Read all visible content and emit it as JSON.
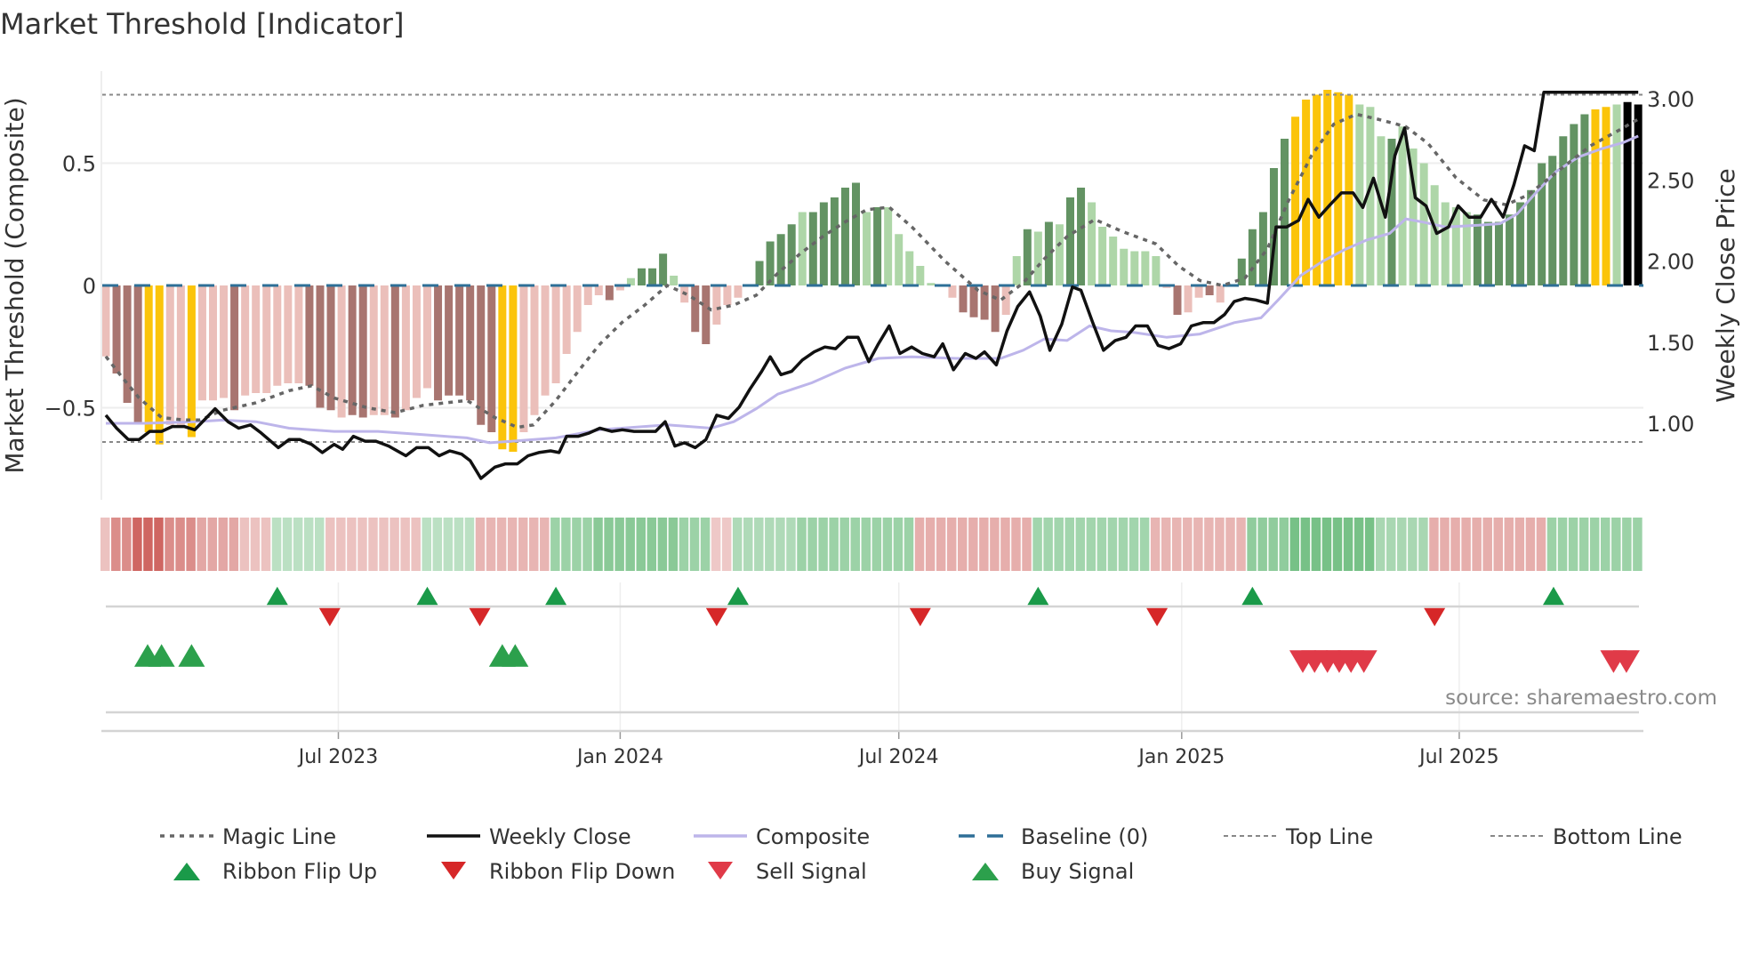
{
  "title": "Market Threshold [Indicator]",
  "source": "source: sharemaestro.com",
  "colors": {
    "bar_L": "#ebbfba",
    "bar_D": "#a87570",
    "bar_Y": "#fbc40a",
    "bar_g": "#aed6a8",
    "bar_G": "#639363",
    "close": "#111111",
    "composite": "#bdb5ea",
    "magic": "#666666",
    "baseline": "#2e6f97",
    "flip_up": "#1a9a49",
    "flip_down": "#d62728",
    "buy": "#2ca04c",
    "sell": "#e03a48"
  },
  "chart_data": {
    "type": "bar",
    "title": "Market Threshold [Indicator]",
    "ylabel_left": "Market Threshold (Composite)",
    "ylabel_right": "Weekly Close Price",
    "ylim_left": [
      -0.88,
      0.88
    ],
    "ylim_right": [
      0.55,
      3.25
    ],
    "left_ticks": [
      {
        "v": 0.5,
        "label": "0.5"
      },
      {
        "v": 0,
        "label": "0"
      },
      {
        "v": -0.5,
        "label": "−0.5"
      }
    ],
    "right_ticks": [
      {
        "v": 3.0,
        "label": "3.00"
      },
      {
        "v": 2.5,
        "label": "2.50"
      },
      {
        "v": 2.0,
        "label": "2.00"
      },
      {
        "v": 1.5,
        "label": "1.50"
      },
      {
        "v": 1.0,
        "label": "1.00"
      }
    ],
    "top_line": 0.78,
    "bottom_line": -0.64,
    "x_ticks": [
      {
        "w": 21.7,
        "label": "Jul 2023"
      },
      {
        "w": 48.0,
        "label": "Jan 2024"
      },
      {
        "w": 74.0,
        "label": "Jul 2024"
      },
      {
        "w": 100.4,
        "label": "Jan 2025"
      },
      {
        "w": 126.3,
        "label": "Jul 2025"
      }
    ],
    "composite_bars": [
      -0.29,
      -0.36,
      -0.48,
      -0.56,
      -0.6,
      -0.65,
      -0.57,
      -0.57,
      -0.62,
      -0.47,
      -0.47,
      -0.46,
      -0.51,
      -0.45,
      -0.44,
      -0.44,
      -0.41,
      -0.4,
      -0.4,
      -0.41,
      -0.5,
      -0.51,
      -0.54,
      -0.53,
      -0.54,
      -0.53,
      -0.53,
      -0.54,
      -0.51,
      -0.46,
      -0.42,
      -0.47,
      -0.45,
      -0.45,
      -0.47,
      -0.57,
      -0.6,
      -0.67,
      -0.68,
      -0.6,
      -0.53,
      -0.45,
      -0.4,
      -0.28,
      -0.19,
      -0.08,
      -0.04,
      -0.06,
      -0.02,
      0.03,
      0.07,
      0.07,
      0.13,
      0.04,
      -0.07,
      -0.19,
      -0.24,
      -0.16,
      -0.08,
      -0.05,
      0,
      0.1,
      0.18,
      0.21,
      0.25,
      0.3,
      0.3,
      0.34,
      0.36,
      0.4,
      0.42,
      0.3,
      0.32,
      0.32,
      0.21,
      0.14,
      0.08,
      0.01,
      0,
      -0.05,
      -0.11,
      -0.13,
      -0.14,
      -0.19,
      -0.12,
      0.12,
      0.23,
      0.22,
      0.26,
      0.25,
      0.36,
      0.4,
      0.34,
      0.24,
      0.2,
      0.15,
      0.14,
      0.14,
      0.12,
      -0.01,
      -0.12,
      -0.11,
      -0.05,
      -0.04,
      -0.07,
      0,
      0.11,
      0.23,
      0.3,
      0.48,
      0.6,
      0.69,
      0.76,
      0.78,
      0.8,
      0.79,
      0.78,
      0.74,
      0.73,
      0.61,
      0.6,
      0.65,
      0.56,
      0.5,
      0.41,
      0.34,
      0.32,
      0.3,
      0.29,
      0.26,
      0.26,
      0.29,
      0.34,
      0.39,
      0.5,
      0.53,
      0.61,
      0.66,
      0.7,
      0.72,
      0.73,
      0.74,
      0.75,
      0.74
    ],
    "bar_colors": "LDDDYYLLYLLLDLLLLLLDDDLDDLLDLLLDDDDDDYYLLLLLLLLDLgGGGgLDDLLLgGGGGgGGGGGgGggggggLDDDDLgGgGgGGgggggggLDLLDLgGGGGGYYYYYYgggGgggggggGGGGGGGGGGGYYg",
    "magic_line": {
      "w": [
        0,
        1.6,
        3.1,
        5.2,
        7.3,
        8.8,
        10.9,
        14,
        17.1,
        19.2,
        21.3,
        24.4,
        27,
        29.6,
        33.7,
        36.3,
        38.4,
        39.9,
        42,
        44.1,
        46.1,
        48.2,
        50.3,
        52.4,
        54.4,
        56.5,
        58.6,
        60.7,
        62.7,
        64.8,
        66.9,
        69,
        71,
        73.1,
        75.2,
        78.3,
        81.4,
        83.5,
        85.6,
        87.6,
        89.7,
        92.3,
        94.9,
        98,
        100.1,
        102.1,
        104.2,
        106.3,
        108.4,
        110.4,
        112.5,
        114.6,
        116.7,
        118.7,
        121.3,
        123.4,
        126,
        128.6,
        130.7,
        132.7,
        135.3,
        138.5,
        141,
        143
      ],
      "v": [
        -0.29,
        -0.38,
        -0.46,
        -0.54,
        -0.55,
        -0.55,
        -0.51,
        -0.48,
        -0.43,
        -0.41,
        -0.46,
        -0.5,
        -0.52,
        -0.49,
        -0.47,
        -0.54,
        -0.58,
        -0.57,
        -0.47,
        -0.35,
        -0.24,
        -0.15,
        -0.08,
        0,
        -0.04,
        -0.1,
        -0.08,
        -0.04,
        0.05,
        0.13,
        0.2,
        0.26,
        0.31,
        0.32,
        0.24,
        0.1,
        -0.02,
        -0.06,
        0.01,
        0.11,
        0.2,
        0.27,
        0.22,
        0.17,
        0.08,
        0.02,
        0,
        0.03,
        0.15,
        0.35,
        0.53,
        0.66,
        0.7,
        0.68,
        0.65,
        0.58,
        0.44,
        0.35,
        0.33,
        0.37,
        0.46,
        0.57,
        0.63,
        0.68
      ]
    },
    "weekly_close": {
      "w": [
        0,
        1,
        2.1,
        3.1,
        4.1,
        5.2,
        6.2,
        7.3,
        8.3,
        10.2,
        11.4,
        12.4,
        13.5,
        14.5,
        16.1,
        17.1,
        18.1,
        19.2,
        20.2,
        21.3,
        22.1,
        23.1,
        24.2,
        25.2,
        26.4,
        28,
        29,
        30.1,
        31.1,
        32.1,
        33.2,
        34,
        35,
        36.3,
        37.3,
        38.4,
        39.4,
        40.4,
        41.5,
        42.3,
        43,
        44.1,
        45.1,
        46.1,
        47.2,
        48.2,
        49.3,
        50.3,
        51.3,
        52.2,
        53.1,
        54,
        55,
        56,
        57,
        58.1,
        59.1,
        60.1,
        61.2,
        62,
        63,
        64,
        65,
        66.1,
        67.1,
        68.1,
        69.2,
        70.2,
        71.2,
        72.1,
        73.1,
        74.1,
        75.2,
        76.2,
        77.3,
        78.1,
        79.1,
        80.2,
        81.2,
        82,
        83.1,
        84.1,
        85.1,
        86.2,
        87.2,
        88.1,
        89.2,
        90.2,
        91,
        92.1,
        93.1,
        94.2,
        95.2,
        96.1,
        97.2,
        98.2,
        99.2,
        100.3,
        101.3,
        102.4,
        103.4,
        104.4,
        105.3,
        106.3,
        107.3,
        108.4,
        109.2,
        110.2,
        111.3,
        112.2,
        113.2,
        114.3,
        115.3,
        116.4,
        117.3,
        118.3,
        119.4,
        120.3,
        121.2,
        122.2,
        123.2,
        124.2,
        125.3,
        126.2,
        127.2,
        128.3,
        129.3,
        130.4,
        131.4,
        132.4,
        133.3,
        134.2,
        143
      ],
      "v": [
        1.05,
        0.97,
        0.9,
        0.9,
        0.95,
        0.95,
        0.98,
        0.98,
        0.96,
        1.09,
        1.01,
        0.97,
        0.99,
        0.94,
        0.85,
        0.9,
        0.9,
        0.87,
        0.82,
        0.87,
        0.84,
        0.92,
        0.89,
        0.89,
        0.86,
        0.8,
        0.85,
        0.85,
        0.8,
        0.83,
        0.81,
        0.77,
        0.66,
        0.73,
        0.75,
        0.75,
        0.8,
        0.82,
        0.83,
        0.82,
        0.92,
        0.92,
        0.94,
        0.97,
        0.95,
        0.96,
        0.95,
        0.95,
        0.95,
        1.01,
        0.86,
        0.88,
        0.85,
        0.9,
        1.05,
        1.03,
        1.1,
        1.21,
        1.32,
        1.41,
        1.3,
        1.32,
        1.39,
        1.44,
        1.47,
        1.46,
        1.53,
        1.53,
        1.38,
        1.49,
        1.6,
        1.43,
        1.47,
        1.43,
        1.41,
        1.49,
        1.33,
        1.43,
        1.4,
        1.44,
        1.36,
        1.57,
        1.72,
        1.81,
        1.66,
        1.45,
        1.61,
        1.84,
        1.82,
        1.62,
        1.45,
        1.51,
        1.53,
        1.6,
        1.6,
        1.48,
        1.46,
        1.49,
        1.6,
        1.62,
        1.62,
        1.67,
        1.75,
        1.77,
        1.76,
        1.74,
        2.21,
        2.21,
        2.25,
        2.38,
        2.27,
        2.35,
        2.42,
        2.42,
        2.33,
        2.51,
        2.27,
        2.65,
        2.82,
        2.39,
        2.34,
        2.17,
        2.21,
        2.34,
        2.27,
        2.27,
        2.38,
        2.27,
        2.47,
        2.71,
        2.68,
        3.04,
        3.04
      ]
    },
    "composite_line": {
      "w": [
        0,
        3.6,
        8.3,
        10.9,
        14,
        17.1,
        21.3,
        25.4,
        29.6,
        33.7,
        35.8,
        37.9,
        42,
        46.1,
        52.4,
        56.5,
        58.6,
        60.7,
        62.7,
        65.9,
        69,
        72.1,
        75.2,
        79.3,
        83.5,
        85.6,
        87.6,
        89.7,
        91.8,
        93.8,
        95.9,
        99,
        102.1,
        105.3,
        107.8,
        109.4,
        111.5,
        113.6,
        115.6,
        117.7,
        119.8,
        121.3,
        122.9,
        125,
        128.1,
        130.1,
        131.7,
        133.3,
        135.3,
        137.4,
        139.5,
        141.6,
        143
      ],
      "v": [
        1,
        1,
        1.01,
        1.02,
        1.01,
        0.97,
        0.95,
        0.95,
        0.93,
        0.91,
        0.88,
        0.89,
        0.91,
        0.96,
        0.99,
        0.97,
        1.01,
        1.09,
        1.18,
        1.25,
        1.34,
        1.4,
        1.41,
        1.4,
        1.4,
        1.45,
        1.52,
        1.51,
        1.6,
        1.57,
        1.56,
        1.53,
        1.55,
        1.62,
        1.65,
        1.76,
        1.91,
        2,
        2.07,
        2.13,
        2.17,
        2.26,
        2.24,
        2.21,
        2.22,
        2.23,
        2.29,
        2.41,
        2.55,
        2.64,
        2.69,
        2.73,
        2.77
      ]
    },
    "ribbon_segments": [
      [
        0,
        0,
        -0.2
      ],
      [
        1,
        2,
        -0.6
      ],
      [
        3,
        5,
        -0.9
      ],
      [
        6,
        8,
        -0.6
      ],
      [
        9,
        12,
        -0.4
      ],
      [
        13,
        15,
        -0.2
      ],
      [
        16,
        20,
        0.2
      ],
      [
        21,
        29,
        -0.2
      ],
      [
        30,
        34,
        0.2
      ],
      [
        35,
        41,
        -0.3
      ],
      [
        42,
        45,
        0.45
      ],
      [
        46,
        53,
        0.6
      ],
      [
        54,
        56,
        0.45
      ],
      [
        57,
        58,
        -0.15
      ],
      [
        59,
        64,
        0.3
      ],
      [
        65,
        75,
        0.45
      ],
      [
        76,
        86,
        -0.35
      ],
      [
        87,
        97,
        0.4
      ],
      [
        98,
        106,
        -0.3
      ],
      [
        107,
        110,
        0.55
      ],
      [
        111,
        118,
        0.75
      ],
      [
        119,
        123,
        0.35
      ],
      [
        124,
        134,
        -0.35
      ],
      [
        135,
        143,
        0.45
      ]
    ],
    "ribbon_flip_up": [
      16,
      30,
      42,
      59,
      87,
      107,
      135.1
    ],
    "ribbon_flip_down": [
      20.9,
      34.9,
      57,
      76,
      98.1,
      124
    ],
    "buy_signals": [
      3.9,
      5.2,
      8,
      37,
      38.2
    ],
    "sell_signals": [
      111.7,
      112.8,
      114,
      115.1,
      116.2,
      117.4,
      140.7,
      141.9
    ],
    "legend_placement": "bottom"
  },
  "legend": [
    {
      "label": "Magic Line",
      "icon": "dotted-line"
    },
    {
      "label": "Weekly Close",
      "icon": "solid-line"
    },
    {
      "label": "Composite",
      "icon": "solid-line"
    },
    {
      "label": "Baseline (0)",
      "icon": "dashed-line"
    },
    {
      "label": "Top Line",
      "icon": "dotted-line"
    },
    {
      "label": "Bottom Line",
      "icon": "dotted-line"
    },
    {
      "label": "Ribbon Flip Up",
      "icon": "triangle-up"
    },
    {
      "label": "Ribbon Flip Down",
      "icon": "triangle-down"
    },
    {
      "label": "Sell Signal",
      "icon": "triangle-down"
    },
    {
      "label": "Buy Signal",
      "icon": "triangle-up"
    }
  ]
}
